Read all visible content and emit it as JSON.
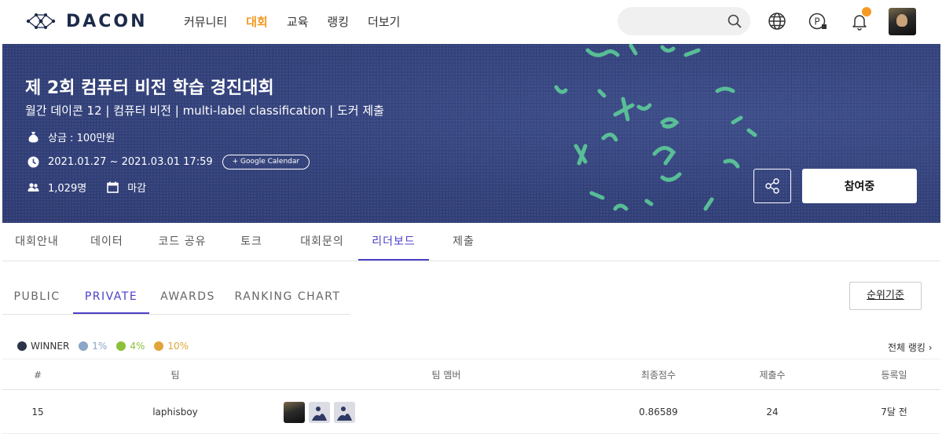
{
  "header": {
    "logo_text": "DACON",
    "nav": [
      {
        "label": "커뮤니티",
        "active": false
      },
      {
        "label": "대회",
        "active": true
      },
      {
        "label": "교육",
        "active": false
      },
      {
        "label": "랭킹",
        "active": false
      },
      {
        "label": "더보기",
        "active": false
      }
    ],
    "search": {
      "placeholder": "",
      "value": ""
    },
    "accent_color": "#f59a23"
  },
  "banner": {
    "title": "제 2회 컴퓨터 비전 학습 경진대회",
    "subtitle": "월간 데이콘 12 | 컴퓨터 비전 | multi-label classification | 도커 제출",
    "prize": "상금 : 100만원",
    "period": "2021.01.27 ~ 2021.03.01 17:59",
    "calendar_button": "+ Google Calendar",
    "participants": "1,029명",
    "status": "마감",
    "join_button": "참여중"
  },
  "tabs": [
    "대회안내",
    "데이터",
    "코드 공유",
    "토크",
    "대회문의",
    "리더보드",
    "제출"
  ],
  "active_tab": "리더보드",
  "subtabs": [
    "PUBLIC",
    "PRIVATE",
    "AWARDS",
    "RANKING CHART"
  ],
  "active_subtab": "PRIVATE",
  "rank_basis_button": "순위기준",
  "legend": [
    {
      "label": "WINNER",
      "color": "#2b3548",
      "text_color": "#333333"
    },
    {
      "label": "1%",
      "color": "#8aa6c8",
      "text_color": "#8aa6c8"
    },
    {
      "label": "4%",
      "color": "#8ac03a",
      "text_color": "#8ac03a"
    },
    {
      "label": "10%",
      "color": "#e0a43a",
      "text_color": "#e0a43a"
    }
  ],
  "full_ranking_link": "전체 랭킹 ›",
  "table": {
    "columns": [
      "#",
      "팀",
      "팀 멤버",
      "최종점수",
      "제출수",
      "등록일"
    ],
    "rows": [
      {
        "rank": "15",
        "team": "laphisboy",
        "score": "0.86589",
        "submissions": "24",
        "registered": "7달 전"
      }
    ]
  },
  "brand_color": "#4b3fc7"
}
